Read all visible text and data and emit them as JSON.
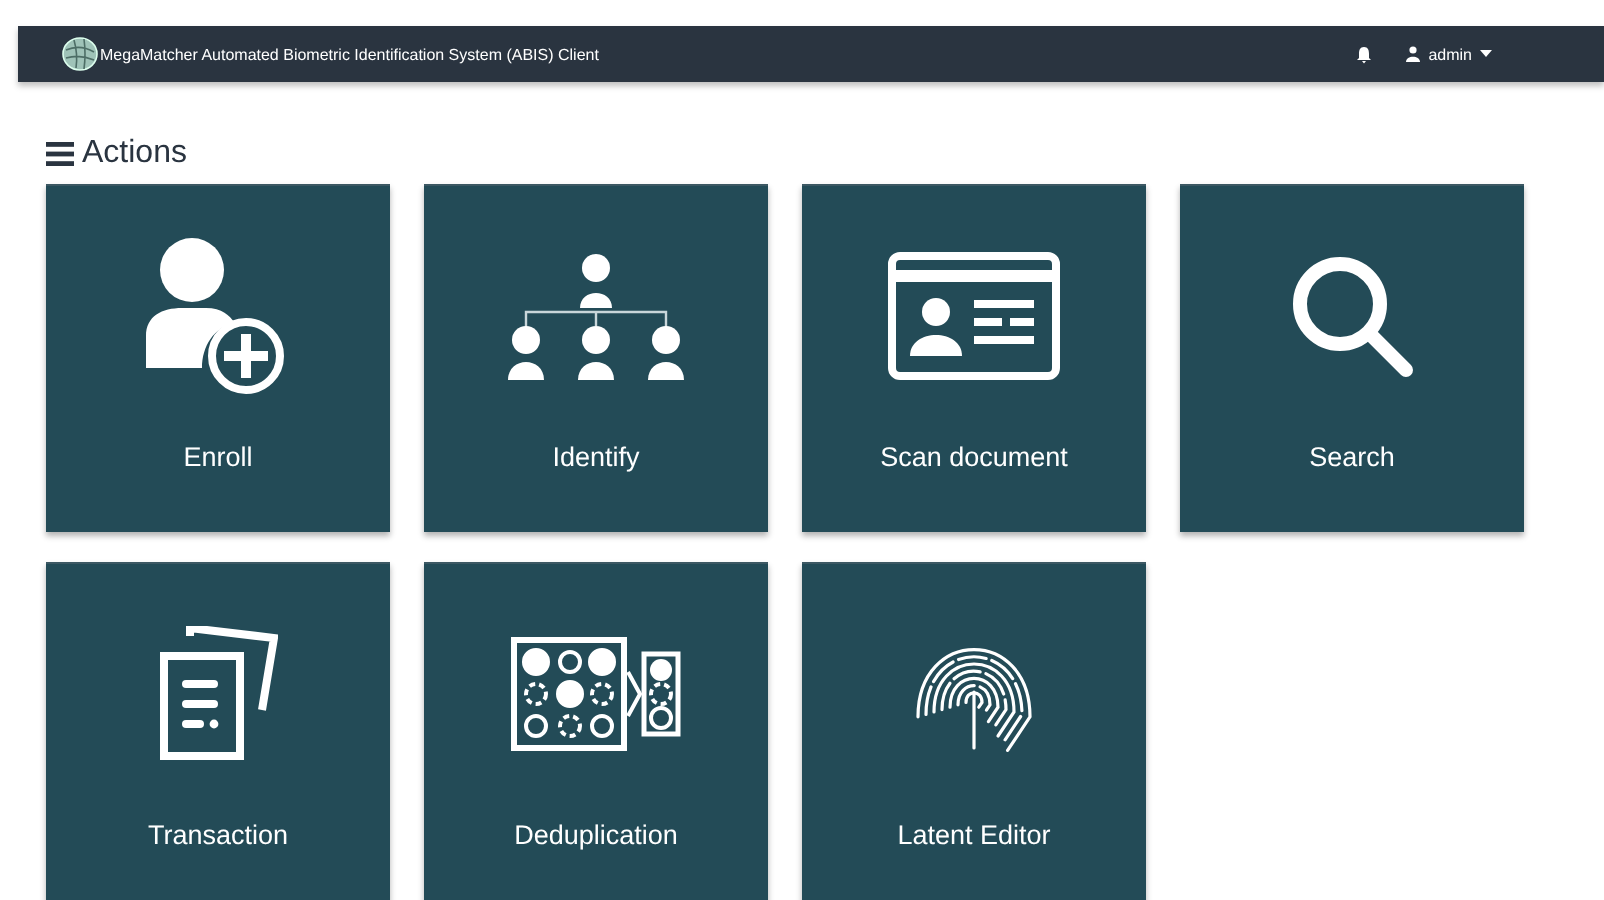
{
  "navbar": {
    "title": "MegaMatcher Automated Biometric Identification System (ABIS) Client",
    "user": "admin"
  },
  "page_title": "Actions",
  "tiles": [
    {
      "kind": "enroll",
      "label": "Enroll"
    },
    {
      "kind": "identify",
      "label": "Identify"
    },
    {
      "kind": "scan",
      "label": "Scan document"
    },
    {
      "kind": "search",
      "label": "Search"
    },
    {
      "kind": "transaction",
      "label": "Transaction"
    },
    {
      "kind": "deduplication",
      "label": "Deduplication"
    },
    {
      "kind": "latent",
      "label": "Latent Editor"
    }
  ]
}
